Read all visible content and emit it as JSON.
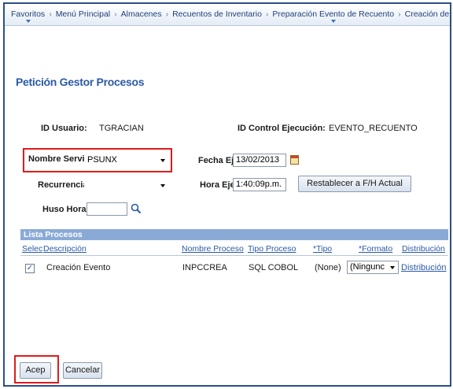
{
  "breadcrumb": {
    "items": [
      "Favoritos",
      "Menú Principal",
      "Almacenes",
      "Recuentos de Inventario",
      "Preparación Evento de Recuento",
      "Creación de Evento de Recue"
    ],
    "separator": "›"
  },
  "page": {
    "title": "Petición Gestor Procesos"
  },
  "form": {
    "user_id_label": "ID Usuario:",
    "user_id_value": "TGRACIAN",
    "run_control_label": "ID Control Ejecución:",
    "run_control_value": "EVENTO_RECUENTO",
    "server_label": "Nombre Servidor:",
    "server_value": "PSUNX",
    "recurrence_label": "Recurrencia:",
    "recurrence_value": "",
    "timezone_label": "Huso Horario:",
    "timezone_value": "",
    "run_date_label": "Fecha Ejec:",
    "run_date_value": "13/02/2013",
    "run_time_label": "Hora Ejec:",
    "run_time_value": "1:40:09p.m.",
    "reset_button": "Restablecer a F/H Actual"
  },
  "process_list": {
    "title": "Lista Procesos",
    "columns": [
      "Selec",
      "Descripción",
      "Nombre Proceso",
      "Tipo Proceso",
      "*Tipo",
      "*Formato",
      "Distribución"
    ],
    "rows": [
      {
        "selected": true,
        "description": "Creación Evento",
        "process_name": "INPCCREA",
        "process_type": "SQL COBOL",
        "type": "(None)",
        "format": "(Ningunc",
        "distribution": "Distribución"
      }
    ]
  },
  "actions": {
    "ok": "Acep",
    "cancel": "Cancelar"
  },
  "colors": {
    "accent": "#2b5aa6",
    "highlight": "#e01b1b",
    "grid_header": "#8aaad6"
  },
  "icons": {
    "calendar": "calendar-icon",
    "lookup": "search-icon"
  }
}
